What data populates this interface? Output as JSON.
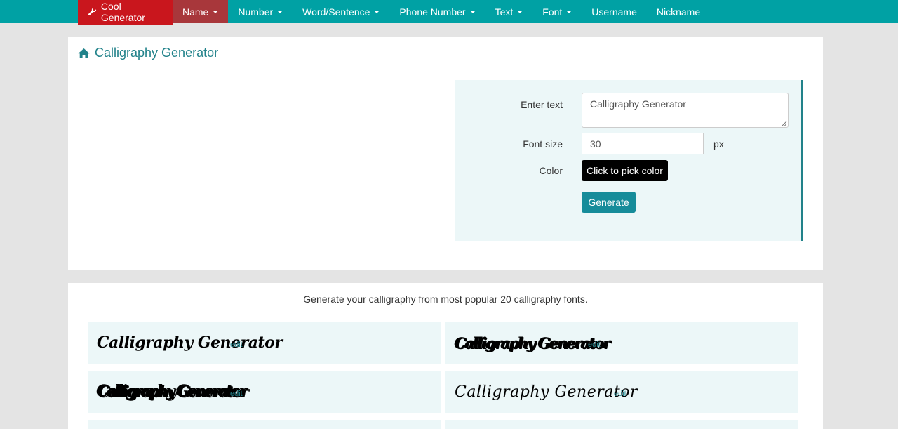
{
  "nav": {
    "brand": "Cool Generator",
    "items": [
      {
        "label": "Name",
        "dropdown": true,
        "active": true
      },
      {
        "label": "Number",
        "dropdown": true
      },
      {
        "label": "Word/Sentence",
        "dropdown": true
      },
      {
        "label": "Phone Number",
        "dropdown": true
      },
      {
        "label": "Text",
        "dropdown": true
      },
      {
        "label": "Font",
        "dropdown": true
      },
      {
        "label": "Username",
        "dropdown": false
      },
      {
        "label": "Nickname",
        "dropdown": false
      }
    ]
  },
  "page": {
    "title": "Calligraphy Generator",
    "title_icon": "home-icon"
  },
  "form": {
    "text_label": "Enter text",
    "text_value": "Calligraphy Generator",
    "size_label": "Font size",
    "size_value": "30",
    "size_unit": "px",
    "color_label": "Color",
    "color_button": "Click to pick color",
    "generate_button": "Generate"
  },
  "results": {
    "intro": "Generate your calligraphy from most popular 20 calligraphy fonts.",
    "samples": [
      {
        "text": "Calligraphy Generator",
        "edit": "edit"
      },
      {
        "text": "Calligraphy Generator",
        "edit": "edit"
      },
      {
        "text": "Calligraphy Generator",
        "edit": "edit"
      },
      {
        "text": "Calligraphy Generator",
        "edit": "edit"
      }
    ]
  },
  "colors": {
    "navbar": "#00a1a4",
    "brand": "#c9161d",
    "active_nav": "#a8373b",
    "accent": "#21828a",
    "generate_button": "#168c9a",
    "panel_bg": "#ecf7f8"
  }
}
